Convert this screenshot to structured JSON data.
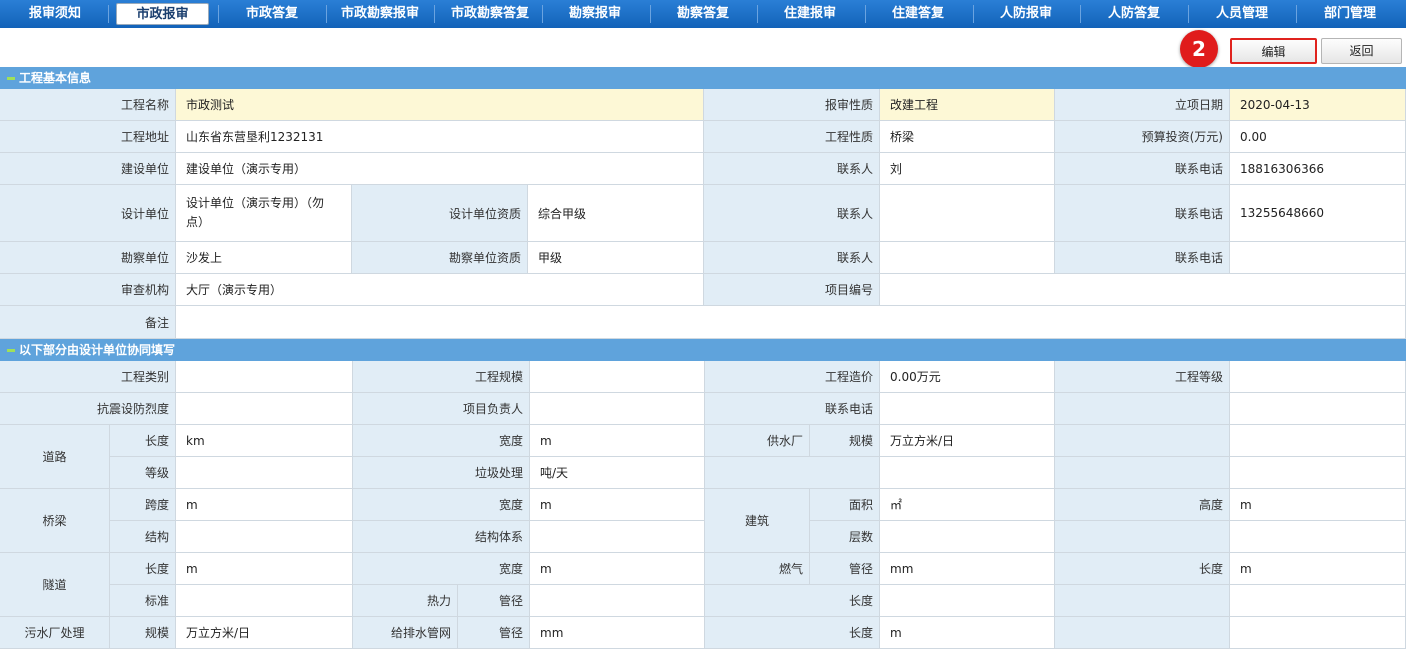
{
  "nav": {
    "tabs": [
      "报审须知",
      "市政报审",
      "市政答复",
      "市政勘察报审",
      "市政勘察答复",
      "勘察报审",
      "勘察答复",
      "住建报审",
      "住建答复",
      "人防报审",
      "人防答复",
      "人员管理",
      "部门管理"
    ],
    "active": 1
  },
  "toolbar": {
    "badge": "2",
    "edit_label": "编辑",
    "back_label": "返回"
  },
  "sections": {
    "basic": "工程基本信息",
    "design": "以下部分由设计单位协同填写"
  },
  "basic": {
    "name_label": "工程名称",
    "name": "市政测试",
    "nature_label": "报审性质",
    "nature": "改建工程",
    "date_label": "立项日期",
    "date": "2020-04-13",
    "address_label": "工程地址",
    "address": "山东省东营垦利1232131",
    "proj_nature_label": "工程性质",
    "proj_nature": "桥梁",
    "budget_label": "预算投资(万元)",
    "budget": "0.00",
    "builder_label": "建设单位",
    "builder": "建设单位（演示专用）",
    "contact_label": "联系人",
    "builder_contact": "刘",
    "phone_label": "联系电话",
    "builder_phone": "18816306366",
    "designer_label": "设计单位",
    "designer": "设计单位（演示专用）（勿点）",
    "designer_qual_label": "设计单位资质",
    "designer_qual": "综合甲级",
    "designer_contact": "",
    "designer_phone": "13255648660",
    "survey_label": "勘察单位",
    "survey": "沙发上",
    "survey_qual_label": "勘察单位资质",
    "survey_qual": "甲级",
    "survey_contact": "",
    "survey_phone": "",
    "review_label": "审查机构",
    "review": "大厅（演示专用）",
    "code_label": "项目编号",
    "code": "",
    "remark_label": "备注",
    "remark": ""
  },
  "design": {
    "category_label": "工程类别",
    "category": "",
    "scale_label": "工程规模",
    "scale": "",
    "cost_label": "工程造价",
    "cost": "0.00万元",
    "grade_label": "工程等级",
    "grade": "",
    "seismic_label": "抗震设防烈度",
    "seismic": "",
    "leader_label": "项目负责人",
    "leader": "",
    "phone_label": "联系电话",
    "phone": "",
    "road_label": "道路",
    "length_label": "长度",
    "road_length": "km",
    "width_label": "宽度",
    "road_width": "m",
    "water_plant_label": "供水厂",
    "scale2_label": "规模",
    "water_scale": "万立方米/日",
    "level_label": "等级",
    "road_level": "",
    "garbage_label": "垃圾处理",
    "garbage": "吨/天",
    "bridge_label": "桥梁",
    "span_label": "跨度",
    "bridge_span": "m",
    "bridge_width": "m",
    "building_label": "建筑",
    "area_label": "面积",
    "building_area": "㎡",
    "height_label": "高度",
    "building_height": "m",
    "structure_label": "结构",
    "bridge_structure": "",
    "structure_system_label": "结构体系",
    "structure_system": "",
    "floors_label": "层数",
    "floors": "",
    "tunnel_label": "隧道",
    "tunnel_length": "m",
    "tunnel_width": "m",
    "gas_label": "燃气",
    "diameter_label": "管径",
    "gas_diameter": "mm",
    "gas_length": "m",
    "standard_label": "标准",
    "tunnel_standard": "",
    "heat_label": "热力",
    "heat_diameter": "",
    "heat_length": "",
    "sewage_label": "污水厂处理",
    "sewage_scale": "万立方米/日",
    "pipe_label": "给排水管网",
    "pipe_diameter": "mm",
    "pipe_length": "m"
  }
}
